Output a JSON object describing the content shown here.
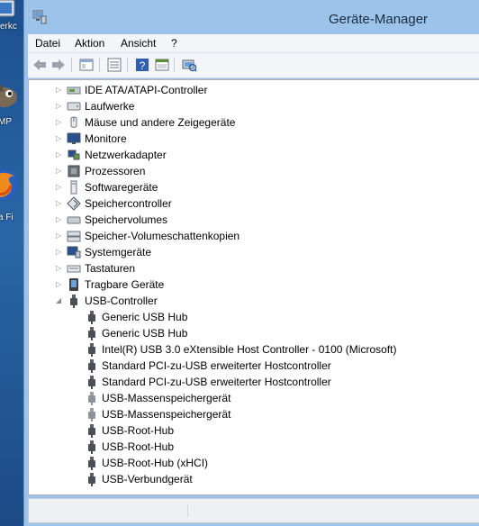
{
  "window": {
    "title": "Geräte-Manager"
  },
  "desktop": {
    "icons": [
      {
        "name": "network-icon",
        "label": "erkc"
      },
      {
        "name": "gimp-icon",
        "label": "MP"
      },
      {
        "name": "firefox-icon",
        "label": "a Fi"
      }
    ]
  },
  "menu": [
    "Datei",
    "Aktion",
    "Ansicht",
    "?"
  ],
  "toolbar": [
    "back",
    "forward",
    "properties-view",
    "device-list",
    "help",
    "update-driver",
    "scan-hardware"
  ],
  "tree": {
    "categories": [
      {
        "label": "IDE ATA/ATAPI-Controller",
        "icon": "ide-controller-icon"
      },
      {
        "label": "Laufwerke",
        "icon": "drive-icon"
      },
      {
        "label": "Mäuse und andere Zeigegeräte",
        "icon": "mouse-icon"
      },
      {
        "label": "Monitore",
        "icon": "monitor-icon"
      },
      {
        "label": "Netzwerkadapter",
        "icon": "network-adapter-icon"
      },
      {
        "label": "Prozessoren",
        "icon": "processor-icon"
      },
      {
        "label": "Softwaregeräte",
        "icon": "software-device-icon"
      },
      {
        "label": "Speichercontroller",
        "icon": "storage-controller-icon"
      },
      {
        "label": "Speichervolumes",
        "icon": "storage-volume-icon"
      },
      {
        "label": "Speicher-Volumeschattenkopien",
        "icon": "shadow-copy-icon"
      },
      {
        "label": "Systemgeräte",
        "icon": "system-device-icon"
      },
      {
        "label": "Tastaturen",
        "icon": "keyboard-icon"
      },
      {
        "label": "Tragbare Geräte",
        "icon": "portable-device-icon"
      }
    ],
    "usb": {
      "label": "USB-Controller",
      "children": [
        "Generic USB Hub",
        "Generic USB Hub",
        "Intel(R) USB 3.0 eXtensible Host Controller - 0100 (Microsoft)",
        "Standard PCI-zu-USB erweiterter Hostcontroller",
        "Standard PCI-zu-USB erweiterter Hostcontroller",
        "USB-Massenspeichergerät",
        "USB-Massenspeichergerät",
        "USB-Root-Hub",
        "USB-Root-Hub",
        "USB-Root-Hub (xHCI)",
        "USB-Verbundgerät"
      ]
    }
  }
}
